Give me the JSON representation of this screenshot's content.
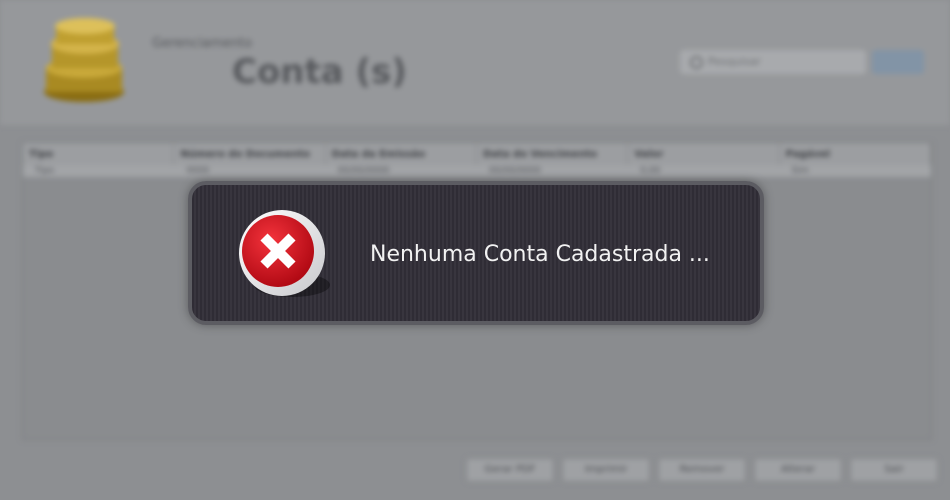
{
  "header": {
    "subtitle": "Gerenciamento",
    "title": "Conta (s)",
    "logo_icon": "coins-icon",
    "search": {
      "placeholder": "Pesquisar",
      "icon": "search-icon"
    }
  },
  "table": {
    "columns": [
      "Tipo",
      "Número do Documento",
      "Data da Emissão",
      "Data do Vencimento",
      "Valor",
      "Pagável"
    ],
    "rows": [
      [
        "Tipo",
        "0000",
        "00/00/0000",
        "00/00/0000",
        "0,00",
        "Sim"
      ]
    ]
  },
  "footer": {
    "buttons": [
      "Gerar PDF",
      "Imprimir",
      "Remover",
      "Alterar",
      "Sair"
    ]
  },
  "alert": {
    "message": "Nenhuma Conta Cadastrada ...",
    "icon": "error-x-icon",
    "colors": {
      "icon_red": "#d4101c",
      "panel": "#33303a",
      "border": "#5c5c62",
      "text": "#f2f2f2"
    }
  }
}
